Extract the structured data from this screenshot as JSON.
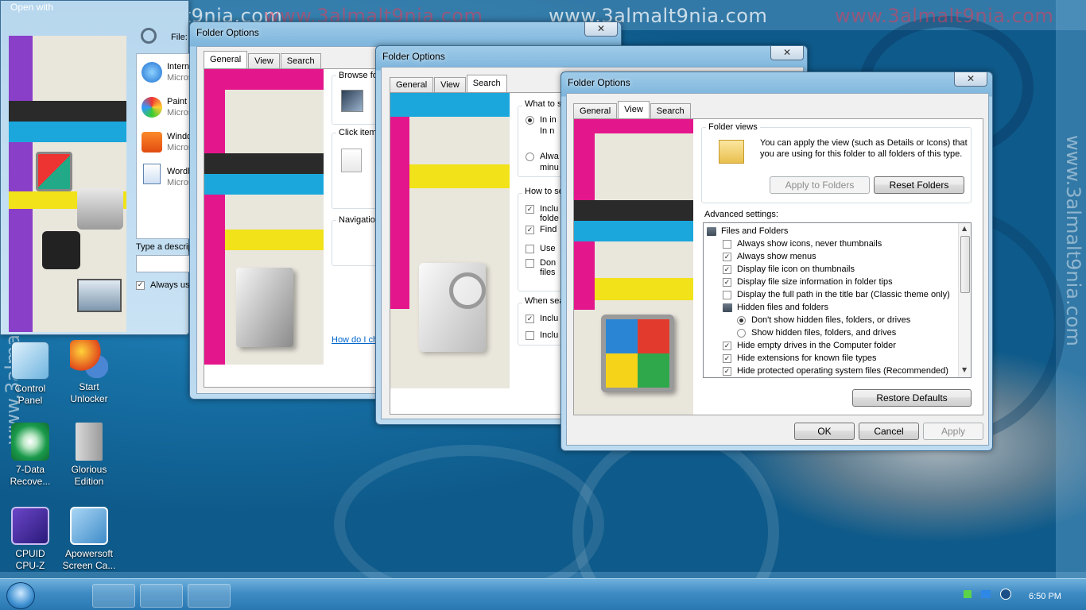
{
  "watermarks": {
    "text": "www.3almalt9nia.com"
  },
  "open_with": {
    "title": "Open with",
    "file_label": "File:",
    "programs": [
      {
        "name": "Intern",
        "vendor": "Micros"
      },
      {
        "name": "Paint",
        "vendor": "Micros"
      },
      {
        "name": "Windo",
        "vendor": "Micros"
      },
      {
        "name": "Wordl",
        "vendor": "Micros"
      }
    ],
    "describe_label": "Type a descrip",
    "always_use_label": "Always use",
    "always_use_checked": true
  },
  "fo_general": {
    "title": "Folder Options",
    "tabs": [
      "General",
      "View",
      "Search"
    ],
    "active_tab": "General",
    "browse_label": "Browse fo",
    "click_label": "Click items",
    "navigation_label": "Navigation",
    "help_link": "How do I ch"
  },
  "fo_search": {
    "title": "Folder Options",
    "tabs": [
      "General",
      "View",
      "Search"
    ],
    "active_tab": "Search",
    "what_label": "What to s",
    "opt1a": "In in",
    "opt1b": "In n",
    "opt2a": "Alwa",
    "opt2b": "minu",
    "how_label": "How to se",
    "how_items": [
      {
        "text": "Inclu",
        "text2": "folde",
        "checked": true
      },
      {
        "text": "Find",
        "text2": "",
        "checked": true
      },
      {
        "text": "Use",
        "text2": "",
        "checked": false
      },
      {
        "text": "Don",
        "text2": "files",
        "checked": false
      }
    ],
    "when_label": "When sea",
    "when_items": [
      {
        "text": "Inclu",
        "checked": true
      },
      {
        "text": "Inclu",
        "checked": false
      }
    ]
  },
  "fo_view": {
    "title": "Folder Options",
    "tabs": [
      "General",
      "View",
      "Search"
    ],
    "active_tab": "View",
    "folder_views_label": "Folder views",
    "folder_views_desc1": "You can apply the view (such as Details or Icons) that",
    "folder_views_desc2": "you are using for this folder to all folders of this type.",
    "apply_folders": "Apply to Folders",
    "reset_folders": "Reset Folders",
    "advanced_label": "Advanced settings:",
    "tree": [
      {
        "kind": "folder",
        "indent": 0,
        "text": "Files and Folders"
      },
      {
        "kind": "check",
        "indent": 1,
        "text": "Always show icons, never thumbnails",
        "checked": false
      },
      {
        "kind": "check",
        "indent": 1,
        "text": "Always show menus",
        "checked": true
      },
      {
        "kind": "check",
        "indent": 1,
        "text": "Display file icon on thumbnails",
        "checked": true
      },
      {
        "kind": "check",
        "indent": 1,
        "text": "Display file size information in folder tips",
        "checked": true
      },
      {
        "kind": "check",
        "indent": 1,
        "text": "Display the full path in the title bar (Classic theme only)",
        "checked": false
      },
      {
        "kind": "folder",
        "indent": 1,
        "text": "Hidden files and folders"
      },
      {
        "kind": "radio",
        "indent": 2,
        "text": "Don't show hidden files, folders, or drives",
        "checked": true
      },
      {
        "kind": "radio",
        "indent": 2,
        "text": "Show hidden files, folders, and drives",
        "checked": false
      },
      {
        "kind": "check",
        "indent": 1,
        "text": "Hide empty drives in the Computer folder",
        "checked": true
      },
      {
        "kind": "check",
        "indent": 1,
        "text": "Hide extensions for known file types",
        "checked": true
      },
      {
        "kind": "check",
        "indent": 1,
        "text": "Hide protected operating system files (Recommended)",
        "checked": true
      }
    ],
    "restore_defaults": "Restore Defaults",
    "ok": "OK",
    "cancel": "Cancel",
    "apply": "Apply"
  },
  "desktop_icons": [
    {
      "line1": "Control",
      "line2": "Panel",
      "icon": "control-panel-icon"
    },
    {
      "line1": "Start",
      "line2": "Unlocker",
      "icon": "unlocker-icon"
    },
    {
      "line1": "7-Data",
      "line2": "Recove...",
      "icon": "data-recovery-icon"
    },
    {
      "line1": "Glorious",
      "line2": "Edition",
      "icon": "glorious-icon"
    },
    {
      "line1": "CPUID",
      "line2": "CPU-Z",
      "icon": "cpuz-icon"
    },
    {
      "line1": "Apowersoft",
      "line2": "Screen Ca...",
      "icon": "apowersoft-icon"
    }
  ],
  "taskbar": {
    "clock": "6:50 PM"
  },
  "colors": {
    "magenta": "#e4168c",
    "cyan": "#1ba7dc",
    "yellow": "#f1e21a",
    "black": "#2a2a2a"
  }
}
